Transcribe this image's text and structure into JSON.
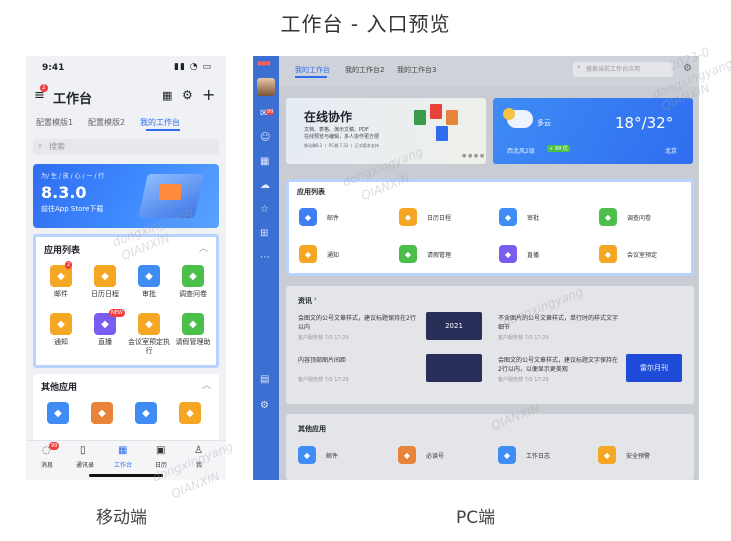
{
  "page_title": "工作台 - 入口预览",
  "captions": {
    "mobile": "移动端",
    "pc": "PC端"
  },
  "watermark": {
    "line1": "2023-0",
    "line2": "dongxingyang",
    "line3": "QIANXIN"
  },
  "mobile": {
    "time": "9:41",
    "header_title": "工作台",
    "menu_badge": "2",
    "tabs": [
      "配置模版1",
      "配置模版2",
      "我的工作台"
    ],
    "search_placeholder": "搜索",
    "banner": {
      "small": "为/ 生 / 放 / 心 / 一 / 行",
      "version": "8.3.0",
      "subtitle": "前往App Store下载"
    },
    "apps_title": "应用列表",
    "apps": [
      {
        "label": "邮件",
        "color": "#f5a623",
        "badge": "2"
      },
      {
        "label": "日历日程",
        "color": "#f5a623",
        "badge": ""
      },
      {
        "label": "审批",
        "color": "#3f8cf5",
        "badge": ""
      },
      {
        "label": "调查问卷",
        "color": "#4cbf4a",
        "badge": ""
      },
      {
        "label": "通知",
        "color": "#f5a623",
        "badge": ""
      },
      {
        "label": "直播",
        "color": "#7b5cf0",
        "badge": "NEW"
      },
      {
        "label": "会议室预定执行",
        "color": "#f5a623",
        "badge": ""
      },
      {
        "label": "请假管理助",
        "color": "#4cbf4a",
        "badge": ""
      }
    ],
    "other_title": "其他应用",
    "other_apps": [
      {
        "color": "#3f8cf5"
      },
      {
        "color": "#e8833a"
      },
      {
        "color": "#3f8cf5"
      },
      {
        "color": "#f5a623"
      }
    ],
    "nav": [
      {
        "label": "消息",
        "badge": "99"
      },
      {
        "label": "通讯录",
        "badge": ""
      },
      {
        "label": "工作台",
        "badge": ""
      },
      {
        "label": "日历",
        "badge": ""
      },
      {
        "label": "我",
        "badge": ""
      }
    ]
  },
  "pc": {
    "tabs": [
      "我的工作台",
      "我的工作台2",
      "我的工作台3"
    ],
    "search_placeholder": "搜索当前工作台应用",
    "rail_badge": "99",
    "banner": {
      "title": "在线协作",
      "line1": "文档、表格、演示文稿、PDF",
      "line2": "在线预览与编辑，多人协作更方便",
      "line3": "移动端8.2 丨 PC端 7.32 丨 正式版本支持"
    },
    "weather": {
      "condition": "多云",
      "range": "18°/32°",
      "wind": "西北风2级",
      "aqi": "+ 99 优",
      "city": "北京"
    },
    "apps_title": "应用列表",
    "apps": [
      {
        "label": "邮件",
        "color": "#3f7ff2"
      },
      {
        "label": "日历日程",
        "color": "#f5a623"
      },
      {
        "label": "审批",
        "color": "#3f8cf5"
      },
      {
        "label": "调查问卷",
        "color": "#4cbf4a"
      },
      {
        "label": "通知",
        "color": "#f5a623"
      },
      {
        "label": "请假管理",
        "color": "#4cbf4a"
      },
      {
        "label": "直播",
        "color": "#7b5cf0"
      },
      {
        "label": "会议室预定",
        "color": "#f5a623"
      }
    ],
    "news_title": "资讯",
    "news": [
      {
        "title": "会图文的公号文章样式，建议标题保持在2行以内",
        "meta": "客户服务部 7/5 17:29",
        "thumb": "2021"
      },
      {
        "title": "不含图片的公号文章样式，单行时的样式文字细节",
        "meta": "客户服务部 7/5 17:29",
        "thumb": ""
      },
      {
        "title": "内容顶部图片间距",
        "meta": "客户服务部 7/5 17:29",
        "thumb": ""
      },
      {
        "title": "会图文的公号文章样式，建议标题文字保持在2行以内，以便显示更美观",
        "meta": "客户服务部 7/5 17:29",
        "thumb": "雷尔月刊"
      }
    ],
    "other_title": "其他应用",
    "other_apps": [
      {
        "label": "邮件",
        "color": "#3f8cf5"
      },
      {
        "label": "必读号",
        "color": "#e8833a"
      },
      {
        "label": "工作日志",
        "color": "#3f8cf5"
      },
      {
        "label": "安全预警",
        "color": "#f5a623"
      }
    ]
  }
}
